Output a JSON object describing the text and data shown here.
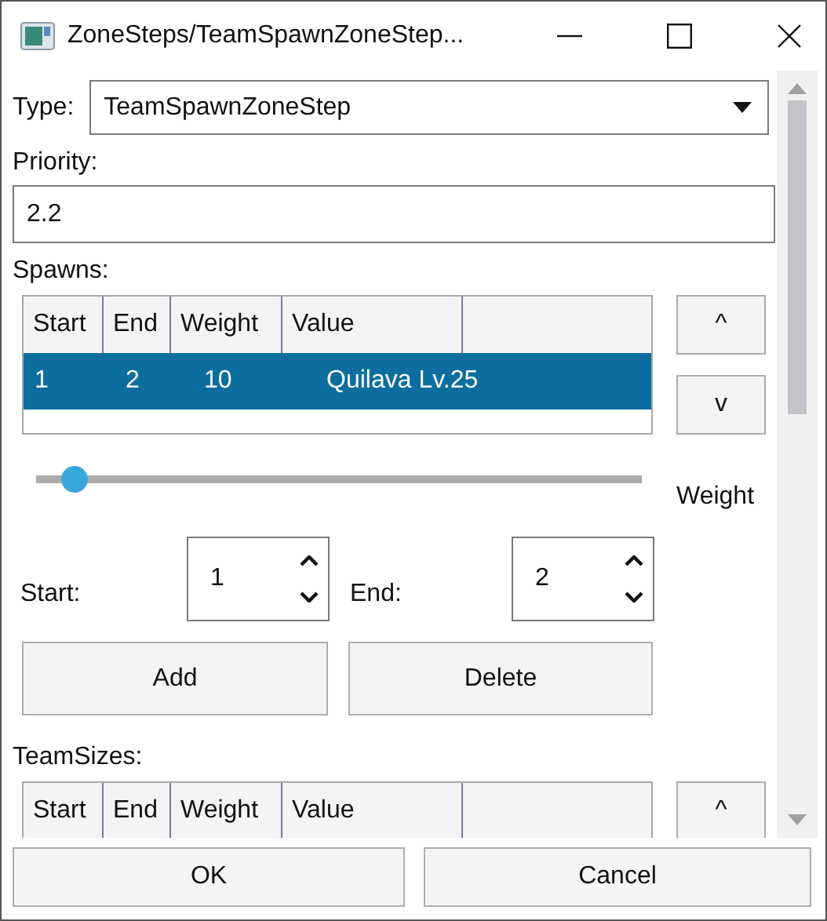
{
  "window": {
    "title": "ZoneSteps/TeamSpawnZoneStep..."
  },
  "type": {
    "label": "Type:",
    "value": "TeamSpawnZoneStep"
  },
  "priority": {
    "label": "Priority:",
    "value": "2.2"
  },
  "spawns": {
    "label": "Spawns:",
    "columns": [
      "Start",
      "End",
      "Weight",
      "Value"
    ],
    "rows": [
      {
        "cells": [
          "1",
          "2",
          "10",
          "Quilava Lv.25"
        ],
        "selected": true
      }
    ],
    "move_buttons": [
      "^",
      "v"
    ],
    "slider": {
      "level": 0.05,
      "label": "Weight"
    },
    "start": {
      "label": "Start:",
      "value": "1"
    },
    "end": {
      "label": "End:",
      "value": "2"
    },
    "buttons": [
      "Add",
      "Delete"
    ]
  },
  "team_sizes": {
    "label": "TeamSizes:",
    "columns": [
      "Start",
      "End",
      "Weight",
      "Value"
    ],
    "move_buttons": [
      "^"
    ]
  },
  "footer_buttons": [
    "OK",
    "Cancel"
  ]
}
